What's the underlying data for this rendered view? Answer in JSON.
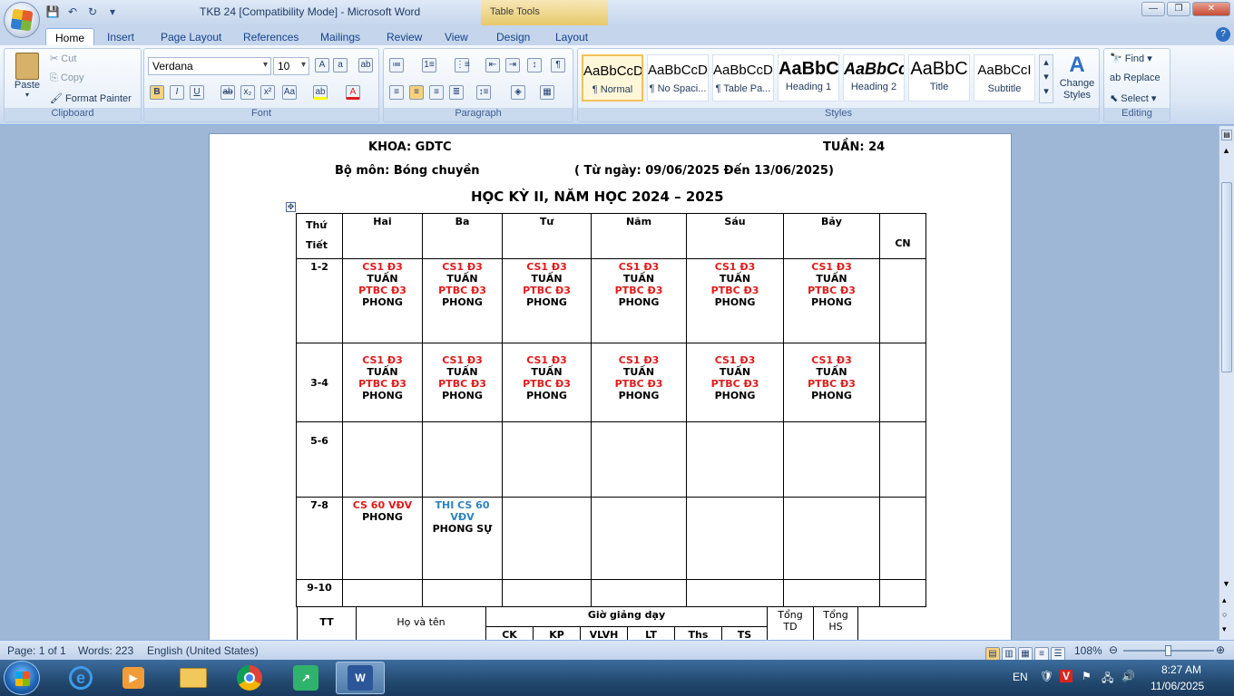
{
  "window": {
    "title": "TKB 24 [Compatibility Mode] - Microsoft Word",
    "contextual_tab_group": "Table Tools"
  },
  "ribbon_tabs": [
    "Home",
    "Insert",
    "Page Layout",
    "References",
    "Mailings",
    "Review",
    "View",
    "Design",
    "Layout"
  ],
  "clipboard": {
    "paste": "Paste",
    "cut": "Cut",
    "copy": "Copy",
    "format_painter": "Format Painter",
    "label": "Clipboard"
  },
  "font": {
    "name": "Verdana",
    "size": "10",
    "label": "Font"
  },
  "paragraph": {
    "label": "Paragraph"
  },
  "styles": {
    "label": "Styles",
    "items": [
      {
        "sample": "AaBbCcDc",
        "name": "¶ Normal"
      },
      {
        "sample": "AaBbCcDc",
        "name": "¶ No Spaci..."
      },
      {
        "sample": "AaBbCcDd",
        "name": "¶ Table Pa..."
      },
      {
        "sample": "AaBbC",
        "name": "Heading 1"
      },
      {
        "sample": "AaBbCc",
        "name": "Heading 2"
      },
      {
        "sample": "AaBbC",
        "name": "Title"
      },
      {
        "sample": "AaBbCcI",
        "name": "Subtitle"
      }
    ],
    "change_styles": "Change Styles"
  },
  "editing": {
    "find": "Find",
    "replace": "Replace",
    "select": "Select",
    "label": "Editing"
  },
  "document": {
    "khoa": "KHOA: GDTC",
    "tuan": "TUẦN: 24",
    "bo_mon": "Bộ môn: Bóng chuyền",
    "date_range": "( Từ ngày: 09/06/2025  Đến 13/06/2025)",
    "semester": "HỌC KỲ II, NĂM HỌC 2024 – 2025",
    "header_thu": "Thứ",
    "header_tiet": "Tiết",
    "days": [
      "Hai",
      "Ba",
      "Tư",
      "Năm",
      "Sáu",
      "Bảy",
      "CN"
    ],
    "rows": [
      {
        "period": "1-2",
        "cells": [
          {
            "l1": "CS1 Đ3",
            "l2": "TUẤN",
            "l3": "PTBC Đ3",
            "l4": "PHONG"
          },
          {
            "l1": "CS1 Đ3",
            "l2": "TUẤN",
            "l3": "PTBC Đ3",
            "l4": "PHONG"
          },
          {
            "l1": "CS1 Đ3",
            "l2": "TUẤN",
            "l3": "PTBC Đ3",
            "l4": "PHONG"
          },
          {
            "l1": "CS1 Đ3",
            "l2": "TUẤN",
            "l3": "PTBC Đ3",
            "l4": "PHONG"
          },
          {
            "l1": "CS1 Đ3",
            "l2": "TUẤN",
            "l3": "PTBC Đ3",
            "l4": "PHONG"
          },
          {
            "l1": "CS1 Đ3",
            "l2": "TUẤN",
            "l3": "PTBC Đ3",
            "l4": "PHONG"
          }
        ]
      },
      {
        "period": "3-4",
        "cells": [
          {
            "l1": "CS1 Đ3",
            "l2": "TUẤN",
            "l3": "PTBC Đ3",
            "l4": "PHONG"
          },
          {
            "l1": "CS1 Đ3",
            "l2": "TUẤN",
            "l3": "PTBC Đ3",
            "l4": "PHONG"
          },
          {
            "l1": "CS1 Đ3",
            "l2": "TUẤN",
            "l3": "PTBC Đ3",
            "l4": "PHONG"
          },
          {
            "l1": "CS1 Đ3",
            "l2": "TUẤN",
            "l3": "PTBC Đ3",
            "l4": "PHONG"
          },
          {
            "l1": "CS1 Đ3",
            "l2": "TUẤN",
            "l3": "PTBC Đ3",
            "l4": "PHONG"
          },
          {
            "l1": "CS1 Đ3",
            "l2": "TUẤN",
            "l3": "PTBC Đ3",
            "l4": "PHONG"
          }
        ]
      },
      {
        "period": "5-6"
      },
      {
        "period": "7-8",
        "mon_a": "CS 60 VĐV",
        "mon_b": "PHONG",
        "tue_a": "THI CS 60 VĐV",
        "tue_b": "PHONG SỰ"
      },
      {
        "period": "9-10"
      }
    ],
    "summary": {
      "tt": "TT",
      "ho_va_ten": "Họ và tên",
      "gio_giang_day": "Giờ giảng dạy",
      "tong_td": "Tổng TD",
      "tong_hs": "Tổng HS",
      "sub": [
        "CK",
        "KP",
        "VLVH",
        "LT",
        "Ths",
        "TS"
      ]
    }
  },
  "status": {
    "page": "Page: 1 of 1",
    "words": "Words: 223",
    "language": "English (United States)",
    "zoom": "108%"
  },
  "tray": {
    "lang": "EN",
    "time": "8:27 AM",
    "date": "11/06/2025"
  }
}
